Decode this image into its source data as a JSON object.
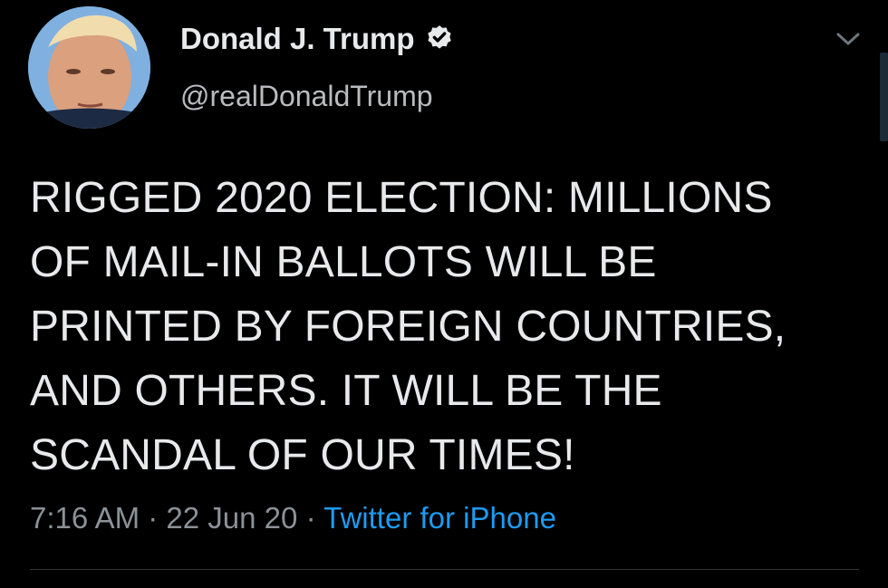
{
  "tweet": {
    "display_name": "Donald J. Trump",
    "handle": "@realDonaldTrump",
    "verified": true,
    "text_lines": [
      "RIGGED 2020 ELECTION: MILLIONS",
      "OF MAIL-IN BALLOTS WILL BE",
      "PRINTED BY FOREIGN COUNTRIES,",
      "AND OTHERS. IT WILL BE THE",
      "SCANDAL OF OUR TIMES!"
    ],
    "time": "7:16 AM",
    "date": "22 Jun 20",
    "separator": "·",
    "source": "Twitter for iPhone"
  },
  "icons": {
    "verified": "verified-badge-icon",
    "menu": "chevron-down-icon"
  },
  "colors": {
    "background": "#000000",
    "text": "#e7e9ea",
    "secondary": "#8b9196",
    "link": "#1d9bf0"
  }
}
